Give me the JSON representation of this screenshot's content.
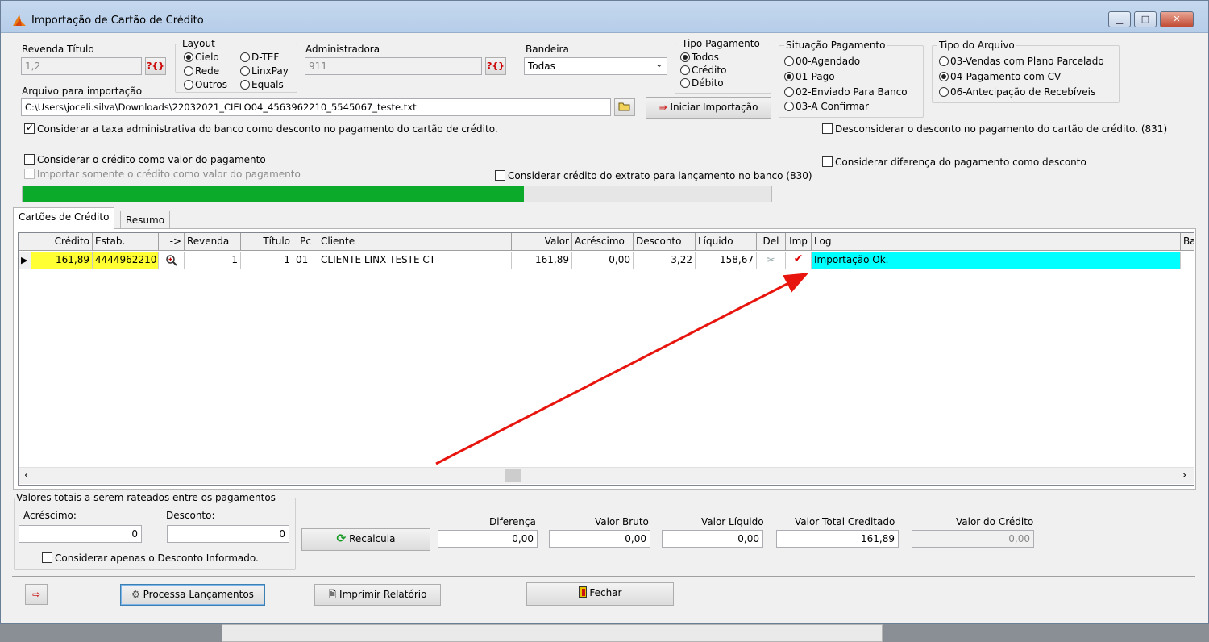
{
  "window": {
    "title": "Importação de Cartão de Crédito",
    "buttons": {
      "minimize": "▁",
      "maximize": "□",
      "close": "✕"
    }
  },
  "form": {
    "revenda_label": "Revenda Título",
    "revenda_value": "1,2",
    "lookup_label": "?{}",
    "layout": {
      "title": "Layout",
      "options": [
        "Cielo",
        "D-TEF",
        "Rede",
        "LinxPay",
        "Outros",
        "Equals"
      ],
      "selected": "Cielo"
    },
    "administradora_label": "Administradora",
    "administradora_value": "911",
    "bandeira_label": "Bandeira",
    "bandeira_value": "Todas",
    "tipo_pagamento": {
      "title": "Tipo Pagamento",
      "options": [
        "Todos",
        "Crédito",
        "Débito"
      ],
      "selected": "Todos"
    },
    "situacao_pagamento": {
      "title": "Situação Pagamento",
      "options": [
        "00-Agendado",
        "01-Pago",
        "02-Enviado Para Banco",
        "03-A Confirmar"
      ],
      "selected": "01-Pago"
    },
    "tipo_arquivo": {
      "title": "Tipo do Arquivo",
      "options": [
        "03-Vendas com Plano Parcelado",
        "04-Pagamento com CV",
        "06-Antecipação de Recebíveis"
      ],
      "selected": "04-Pagamento com CV"
    },
    "arquivo_label": "Arquivo para importação",
    "arquivo_value": "C:\\Users\\joceli.silva\\Downloads\\22032021_CIELO04_4563962210_5545067_teste.txt",
    "iniciar_label": "Iniciar Importação",
    "checks": {
      "taxa_admin": "Considerar a taxa administrativa do banco como desconto no pagamento do cartão de crédito.",
      "desconsiderar": "Desconsiderar o desconto no pagamento do cartão de crédito. (831)",
      "credito_valor": "Considerar o crédito como valor do pagamento",
      "diferenca": "Considerar diferença do pagamento como desconto",
      "importar_somente": "Importar somente o crédito como valor do pagamento",
      "credito_extrato": "Considerar crédito do extrato para lançamento no banco (830)"
    },
    "progress": 0.67,
    "progress_color": "#0caa2b"
  },
  "tabs": [
    "Cartões de Crédito",
    "Resumo"
  ],
  "grid": {
    "columns": [
      "Crédito",
      "Estab.",
      "->",
      "Revenda",
      "Título",
      "Pc",
      "Cliente",
      "Valor",
      "Acréscimo",
      "Desconto",
      "Líquido",
      "Del",
      "Imp",
      "Log",
      "Ba"
    ],
    "row": {
      "credito": "161,89",
      "estab": "4444962210",
      "revenda": "1",
      "titulo": "1",
      "pc": "01",
      "cliente": "CLIENTE LINX TESTE CT",
      "valor": "161,89",
      "acrescimo": "0,00",
      "desconto": "3,22",
      "liquido": "158,67",
      "log": "Importação Ok."
    },
    "highlight_color": "#ffff33",
    "log_color": "#00ffff"
  },
  "totais": {
    "title": "Valores totais a serem rateados entre os pagamentos",
    "acrescimo_label": "Acréscimo:",
    "acrescimo_value": "0",
    "desconto_label": "Desconto:",
    "desconto_value": "0",
    "apenas_desconto": "Considerar apenas o Desconto Informado."
  },
  "recalcula_label": "Recalcula",
  "summary": {
    "diferenca_label": "Diferença",
    "diferenca_value": "0,00",
    "bruto_label": "Valor Bruto",
    "bruto_value": "0,00",
    "liquido_label": "Valor Líquido",
    "liquido_value": "0,00",
    "creditado_label": "Valor Total Creditado",
    "creditado_value": "161,89",
    "credito_label": "Valor do Crédito",
    "credito_value": "0,00"
  },
  "footer": {
    "processa_label": "Processa Lançamentos",
    "imprimir_label": "Imprimir Relatório",
    "fechar_label": "Fechar"
  },
  "annotation_color": "#e8150f"
}
